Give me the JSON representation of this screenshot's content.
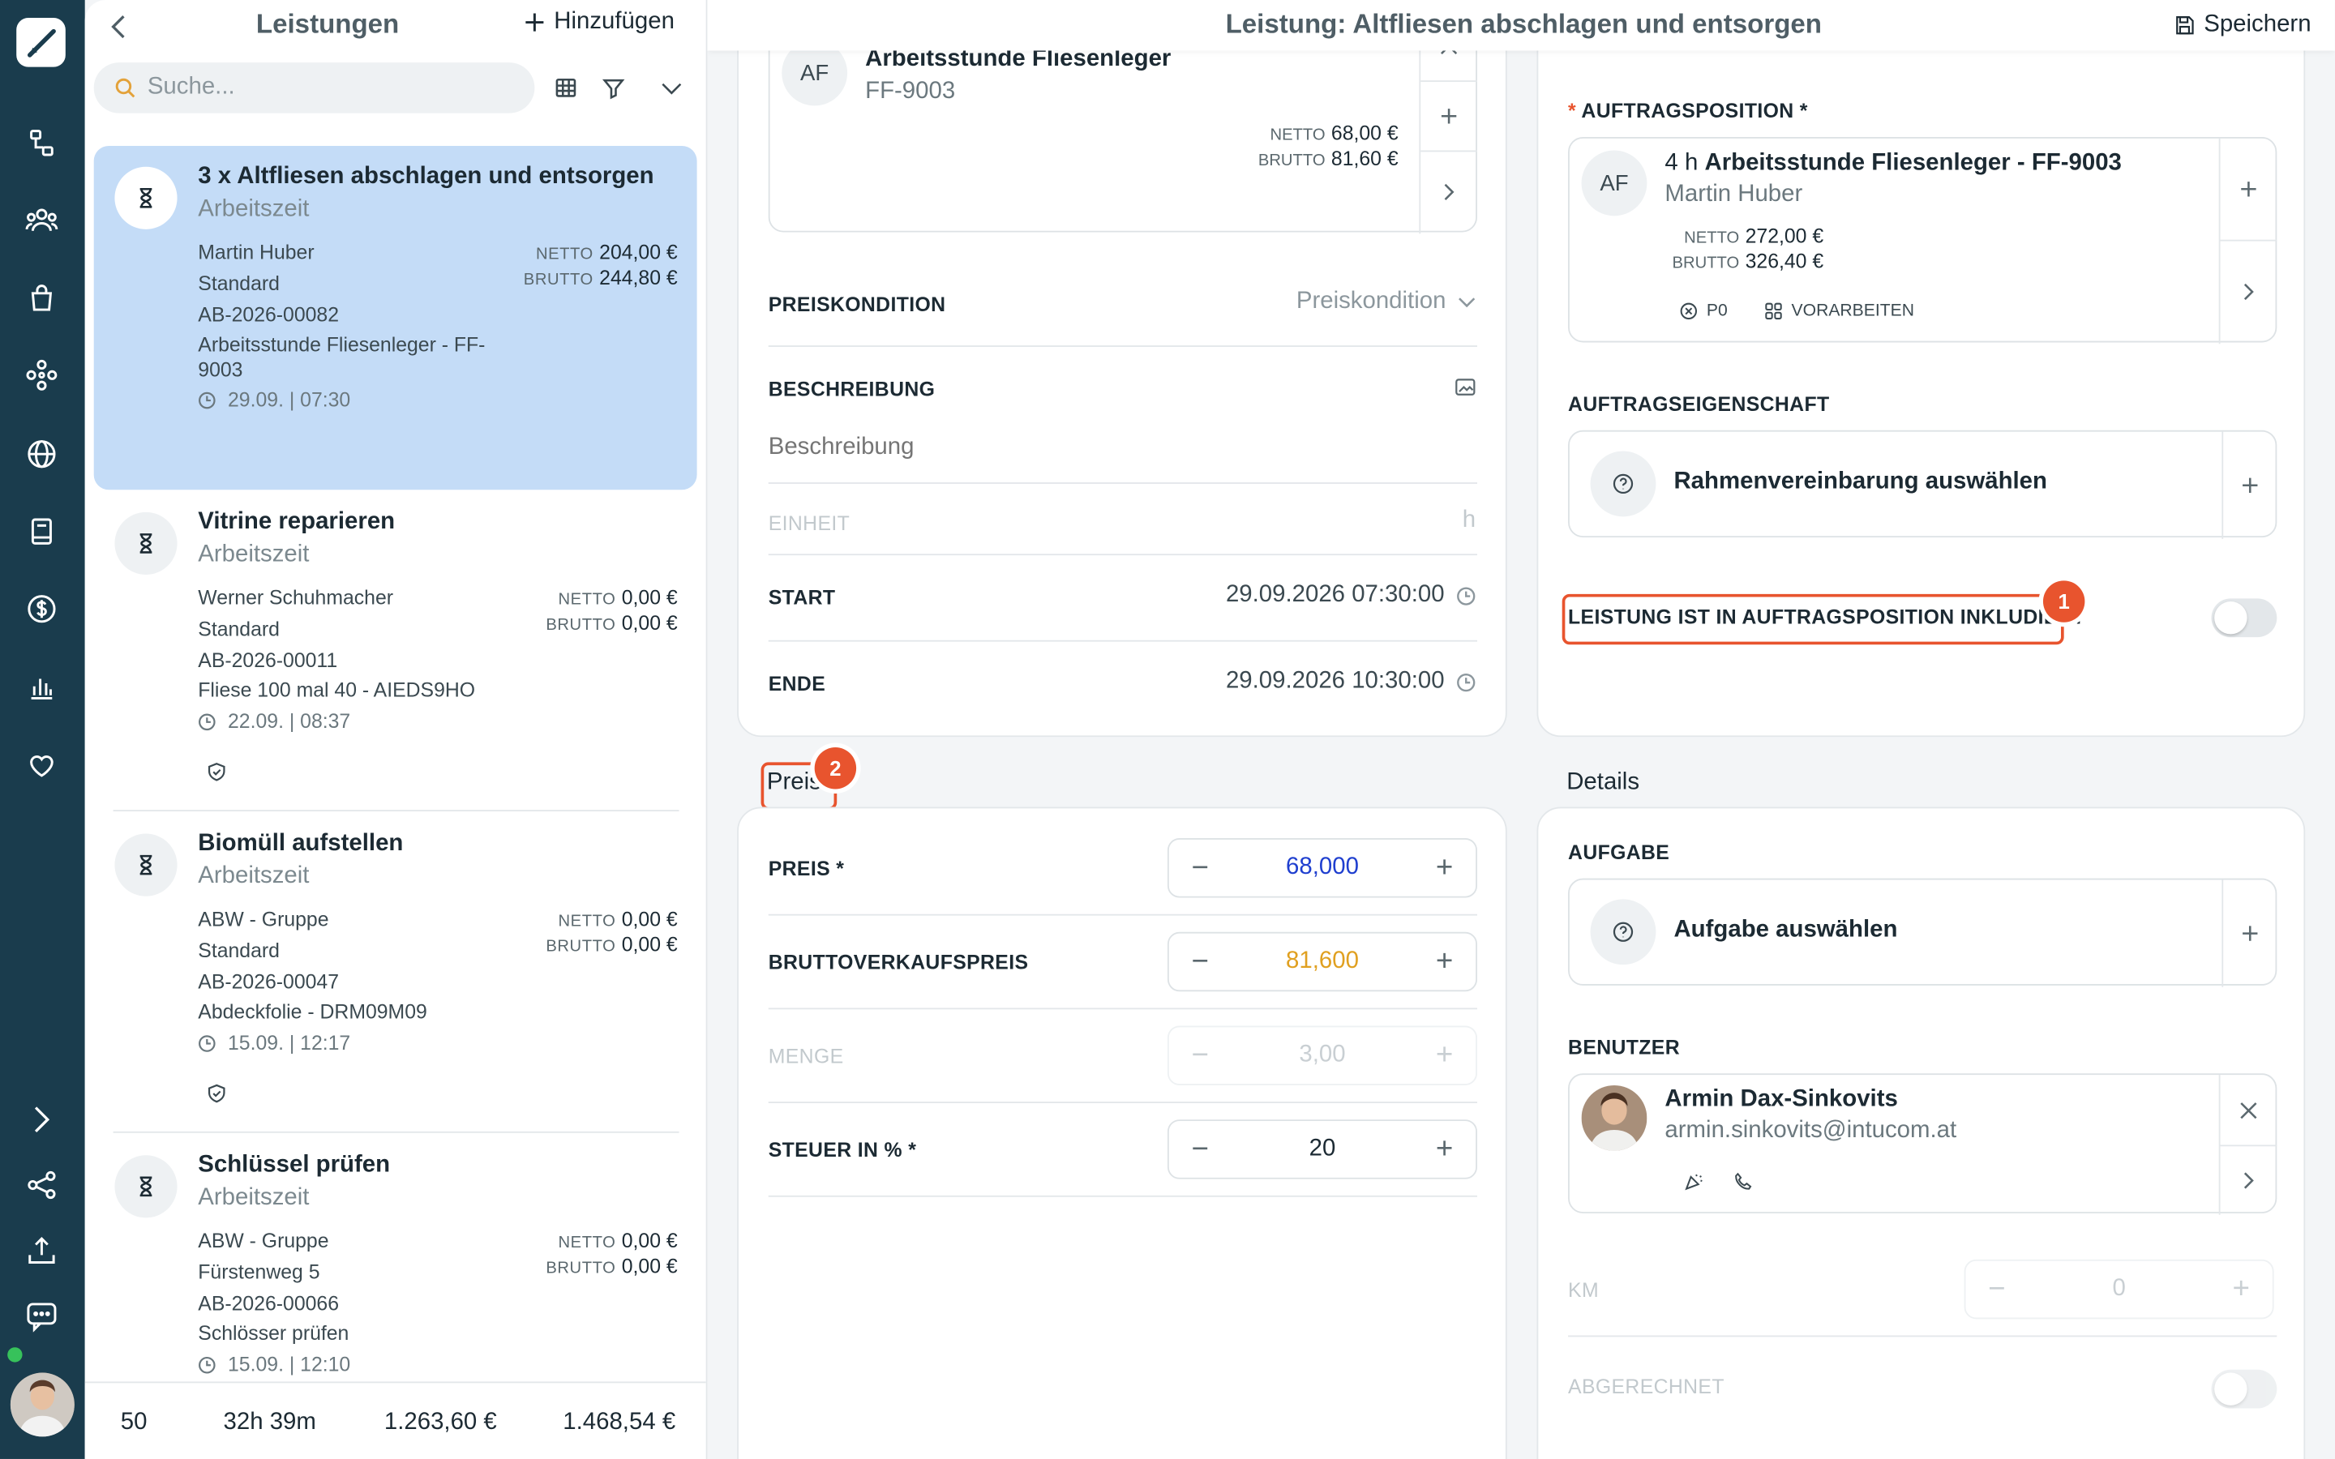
{
  "list": {
    "title": "Leistungen",
    "add_label": "Hinzufügen",
    "search_placeholder": "Suche...",
    "items": [
      {
        "qty": "3 x",
        "title": "Altfliesen abschlagen und entsorgen",
        "subtitle": "Arbeitszeit",
        "user": "Martin Huber",
        "line2": "Standard",
        "line3": "AB-2026-00082",
        "line4": "Arbeitsstunde Fliesenleger - FF-",
        "line5": "9003",
        "date": "29.09. | 07:30",
        "netto_label": "NETTO",
        "netto": "204,00 €",
        "brutto_label": "BRUTTO",
        "brutto": "244,80 €"
      },
      {
        "title": "Vitrine reparieren",
        "subtitle": "Arbeitszeit",
        "user": "Werner Schuhmacher",
        "line2": "Standard",
        "line3": "AB-2026-00011",
        "line4": "Fliese 100 mal 40 - AIEDS9HO",
        "date": "22.09. | 08:37",
        "netto_label": "NETTO",
        "netto": "0,00 €",
        "brutto_label": "BRUTTO",
        "brutto": "0,00 €"
      },
      {
        "title": "Biomüll aufstellen",
        "subtitle": "Arbeitszeit",
        "user": "ABW - Gruppe",
        "line2": "Standard",
        "line3": "AB-2026-00047",
        "line4": "Abdeckfolie - DRM09M09",
        "date": "15.09. | 12:17",
        "netto_label": "NETTO",
        "netto": "0,00 €",
        "brutto_label": "BRUTTO",
        "brutto": "0,00 €"
      },
      {
        "title": "Schlüssel prüfen",
        "subtitle": "Arbeitszeit",
        "user": "ABW - Gruppe",
        "line2": "Fürstenweg 5",
        "line3": "AB-2026-00066",
        "line4": "Schlösser prüfen",
        "date": "15.09. | 12:10",
        "netto_label": "NETTO",
        "netto": "0,00 €",
        "brutto_label": "BRUTTO",
        "brutto": "0,00 €"
      }
    ],
    "footer": {
      "count": "50",
      "duration": "32h 39m",
      "netto_total": "1.263,60 €",
      "brutto_total": "1.468,54 €"
    }
  },
  "main": {
    "title": "Leistung: Altfliesen abschlagen und entsorgen",
    "save_label": "Speichern",
    "article": {
      "avatar": "AF",
      "name": "Arbeitsstunde Fliesenleger",
      "code": "FF-9003",
      "netto_label": "NETTO",
      "netto": "68,00 €",
      "brutto_label": "BRUTTO",
      "brutto": "81,60 €"
    },
    "preiskondition": {
      "label": "PREISKONDITION",
      "value": "Preiskondition"
    },
    "beschreibung": {
      "label": "BESCHREIBUNG",
      "placeholder": "Beschreibung"
    },
    "einheit": {
      "label": "EINHEIT",
      "value": "h"
    },
    "start": {
      "label": "START",
      "value": "29.09.2026 07:30:00"
    },
    "ende": {
      "label": "ENDE",
      "value": "29.09.2026 10:30:00"
    },
    "auftragsposition": {
      "label": "AUFTRAGSPOSITION *",
      "required_mark": "*",
      "avatar": "AF",
      "qty": "4 h",
      "name": "Arbeitsstunde Fliesenleger - FF-9003",
      "user": "Martin Huber",
      "netto_label": "NETTO",
      "netto": "272,00 €",
      "brutto_label": "BRUTTO",
      "brutto": "326,40 €",
      "tag1": "P0",
      "tag2": "VORARBEITEN"
    },
    "auftragseigenschaft": {
      "label": "AUFTRAGSEIGENSCHAFT",
      "value": "Rahmenvereinbarung auswählen"
    },
    "inkludiert": {
      "label": "LEISTUNG IST IN AUFTRAGSPOSITION INKLUDIERT",
      "badge": "1"
    },
    "preis_section": {
      "title": "Preis",
      "badge": "2"
    },
    "preis": {
      "label": "PREIS *",
      "value": "68,000",
      "color": "#1f3fcf"
    },
    "brutto_vk": {
      "label": "BRUTTOVERKAUFSPREIS",
      "value": "81,600",
      "color": "#e0a020"
    },
    "menge": {
      "label": "MENGE",
      "value": "3,00"
    },
    "steuer": {
      "label": "STEUER IN % *",
      "value": "20"
    },
    "details_section": {
      "title": "Details"
    },
    "aufgabe": {
      "label": "AUFGABE",
      "value": "Aufgabe auswählen"
    },
    "benutzer": {
      "label": "BENUTZER",
      "name": "Armin Dax-Sinkovits",
      "email": "armin.sinkovits@intucom.at"
    },
    "km": {
      "label": "KM",
      "value": "0"
    },
    "abgerechnet": {
      "label": "ABGERECHNET"
    }
  },
  "colors": {
    "rail": "#1a3c4d",
    "selected": "#c4dcf7",
    "accent_red": "#e8542e"
  }
}
